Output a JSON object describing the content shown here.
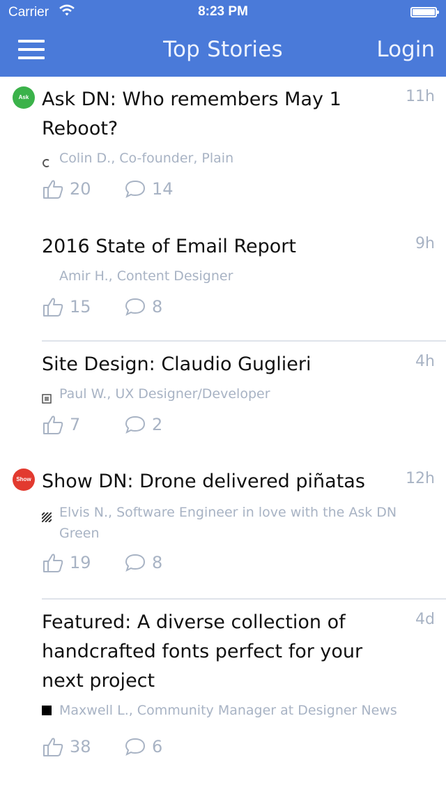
{
  "status_bar": {
    "carrier": "Carrier",
    "time": "8:23 PM"
  },
  "nav": {
    "title": "Top Stories",
    "login_label": "Login"
  },
  "stories": [
    {
      "badge": "Ask",
      "badge_color": "#3bb24a",
      "title": "Ask DN: Who remembers May 1 Reboot?",
      "time": "11h",
      "author": "Colin D., Co-founder, Plain",
      "upvotes": "20",
      "comments": "14"
    },
    {
      "title": "2016 State of Email Report",
      "time": "9h",
      "author": "Amir H., Content Designer",
      "upvotes": "15",
      "comments": "8"
    },
    {
      "title": "Site Design: Claudio Guglieri",
      "time": "4h",
      "author": "Paul W., UX Designer/Developer",
      "upvotes": "7",
      "comments": "2"
    },
    {
      "badge": "Show",
      "badge_color": "#e23a2f",
      "title": "Show DN: Drone delivered piñatas",
      "time": "12h",
      "author": "Elvis N., Software Engineer in love with the Ask DN Green",
      "upvotes": "19",
      "comments": "8"
    },
    {
      "title": "Featured: A diverse collection of handcrafted fonts perfect for your next project",
      "time": "4d",
      "author": "Maxwell L., Community Manager at Designer News",
      "upvotes": "38",
      "comments": "6"
    }
  ]
}
